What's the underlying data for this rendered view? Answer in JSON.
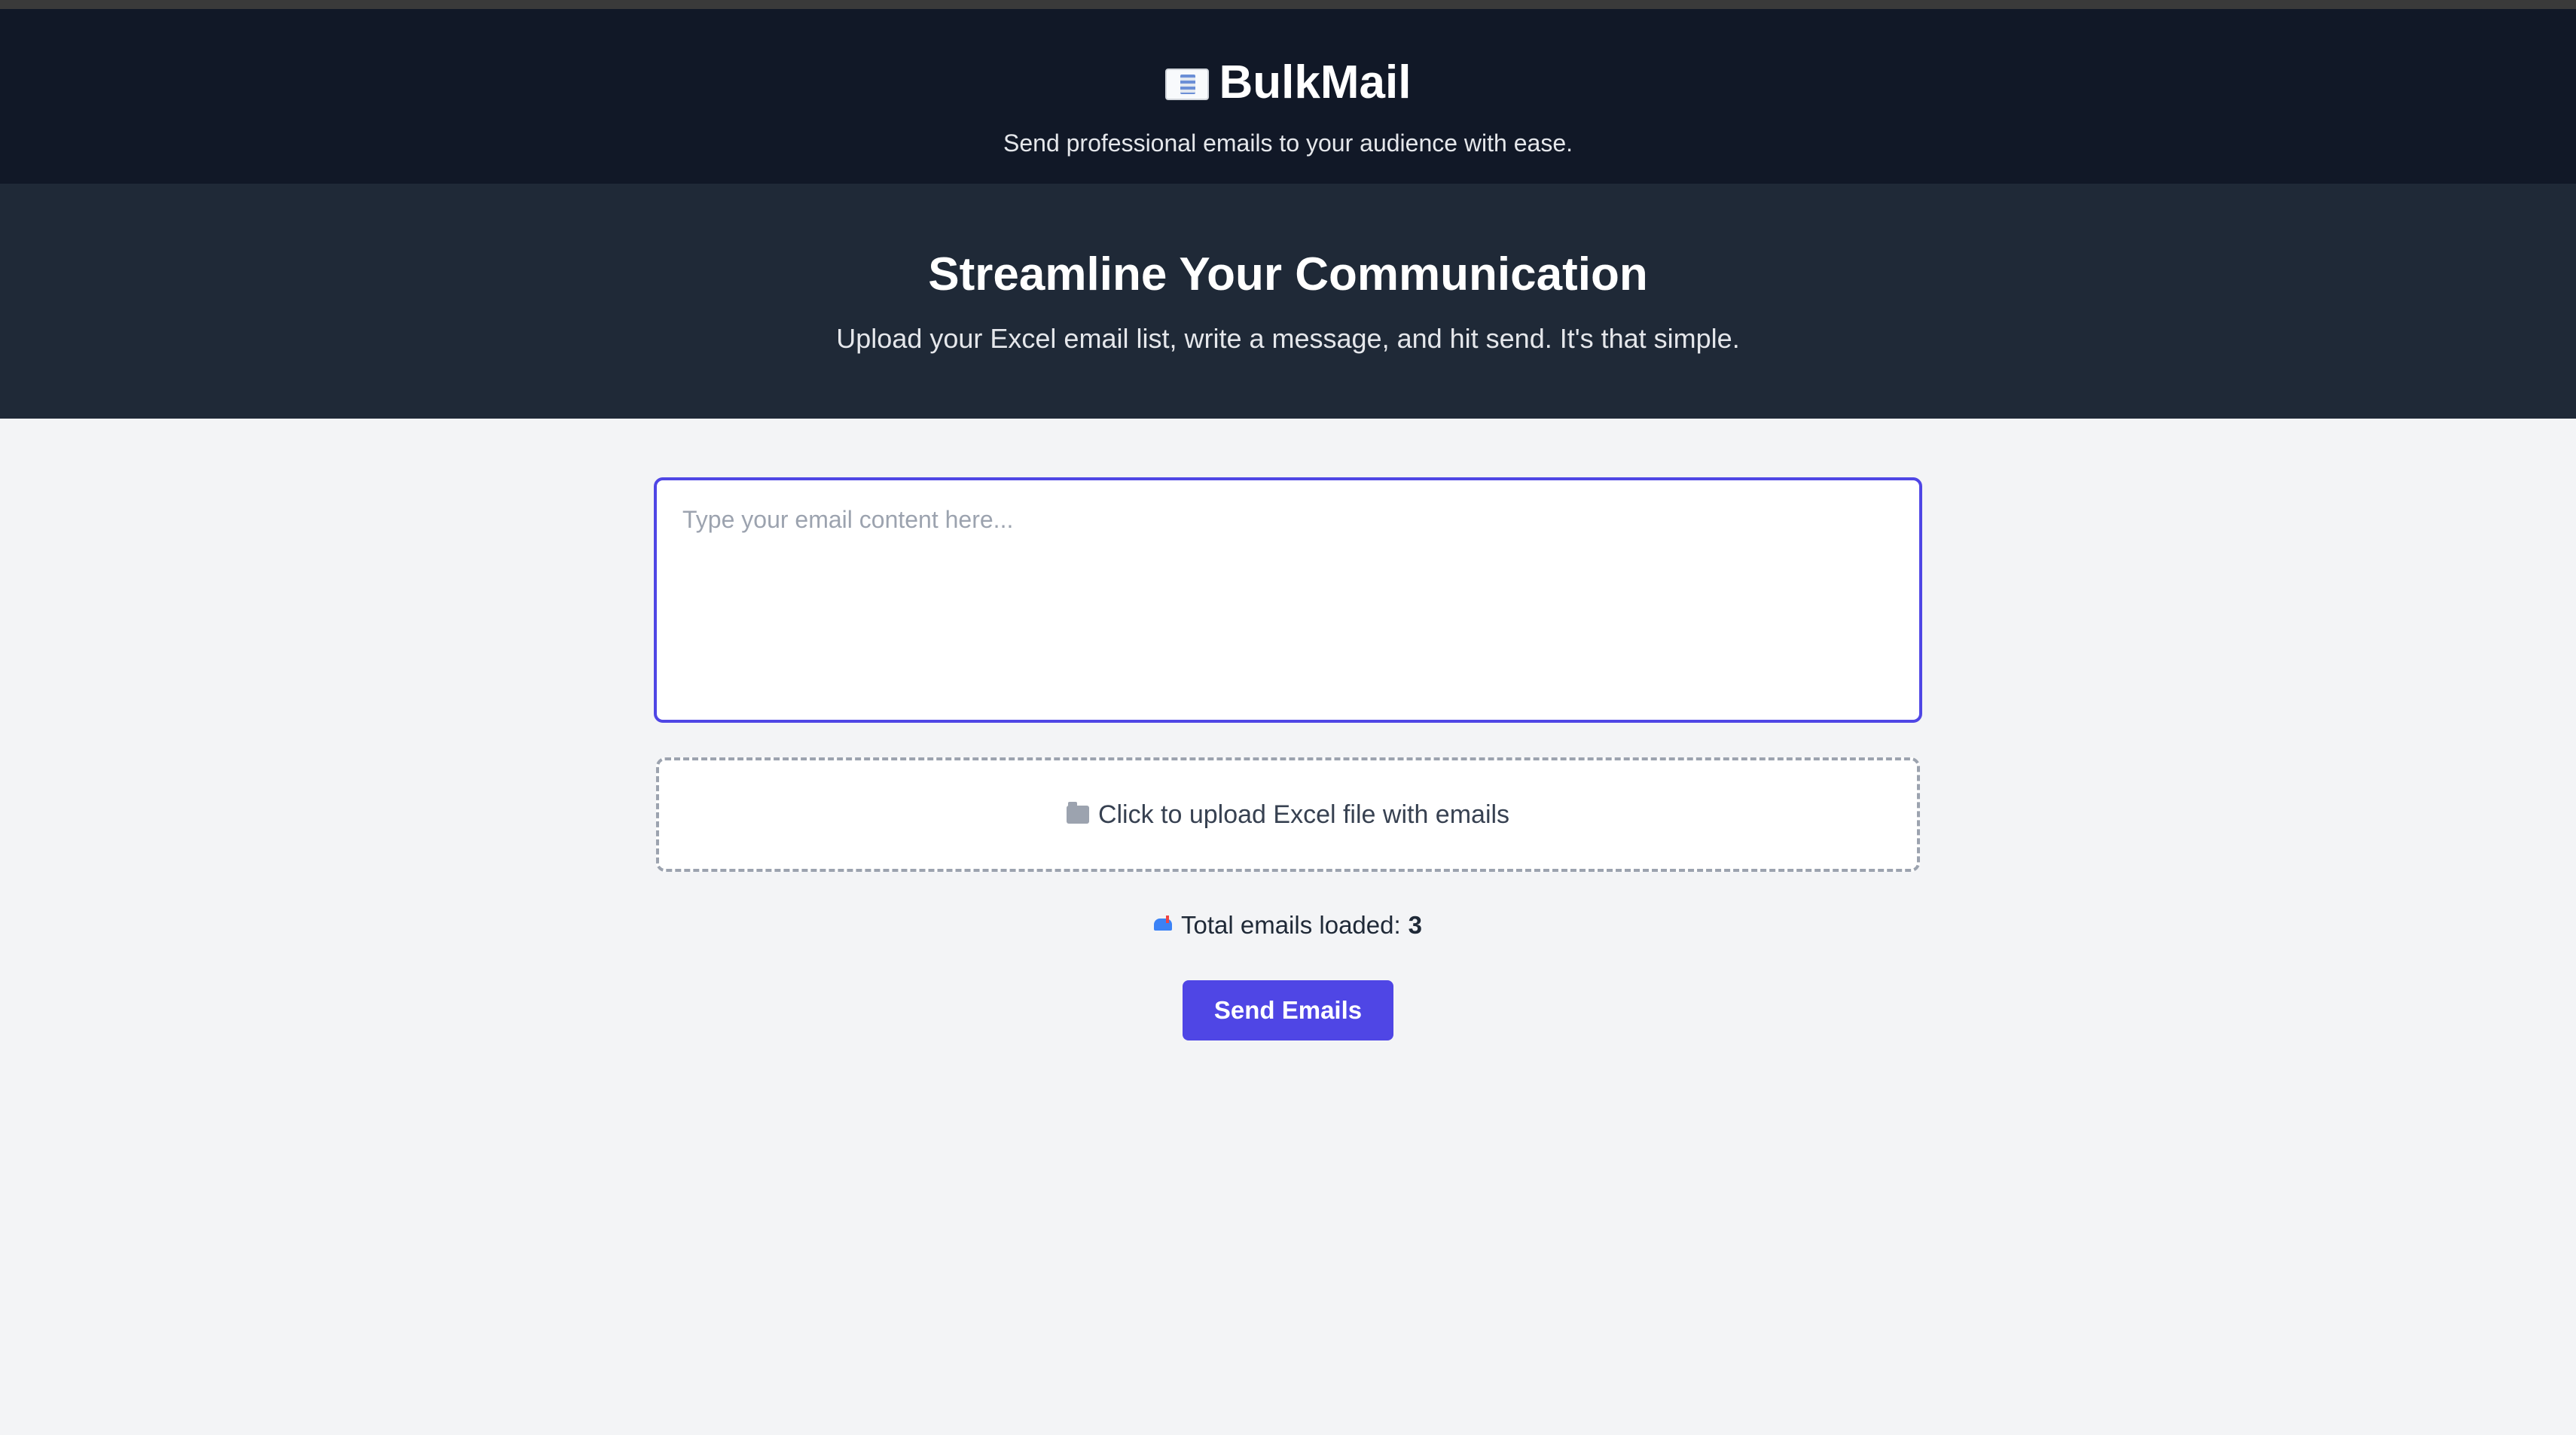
{
  "app": {
    "brand_name": "BulkMail",
    "brand_icon": "envelope-icon",
    "tagline": "Send professional emails to your audience with ease."
  },
  "hero": {
    "title": "Streamline Your Communication",
    "subtitle": "Upload your Excel email list, write a message, and hit send. It's that simple."
  },
  "composer": {
    "value": "",
    "placeholder": "Type your email content here..."
  },
  "upload": {
    "icon": "folder-icon",
    "label": "Click to upload Excel file with emails"
  },
  "stats": {
    "icon": "mailbox-icon",
    "label": "Total emails loaded:",
    "count": "3"
  },
  "actions": {
    "send_label": "Send Emails"
  },
  "colors": {
    "header_bg": "#111827",
    "hero_bg": "#1f2937",
    "page_bg": "#f3f4f6",
    "accent": "#4f46e5"
  }
}
